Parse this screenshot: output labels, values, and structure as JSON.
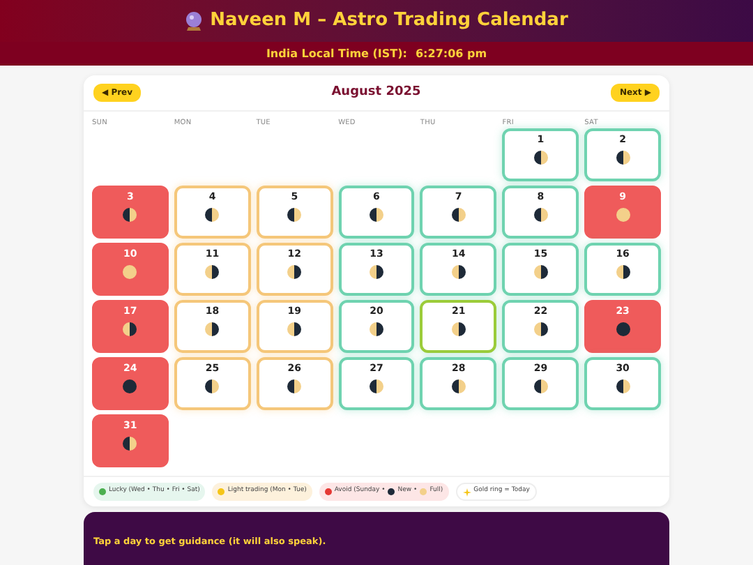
{
  "header": {
    "title": "Naveen M – Astro Trading Calendar"
  },
  "time_bar": {
    "label": "India Local Time (IST):",
    "time": "6:27:06 pm"
  },
  "calendar": {
    "prev": "◀ Prev",
    "month": "August 2025",
    "next": "Next ▶",
    "weekdays": [
      "SUN",
      "MON",
      "TUE",
      "WED",
      "THU",
      "FRI",
      "SAT"
    ],
    "days": [
      {
        "day": "1",
        "kind": "lucky",
        "moon": {
          "kind": "waxing"
        },
        "today": false
      },
      {
        "day": "2",
        "kind": "lucky",
        "moon": {
          "kind": "waxing"
        },
        "today": false
      },
      {
        "day": "3",
        "kind": "avoid",
        "moon": {
          "kind": "waxing"
        },
        "today": false
      },
      {
        "day": "4",
        "kind": "light",
        "moon": {
          "kind": "waxing"
        },
        "today": false
      },
      {
        "day": "5",
        "kind": "light",
        "moon": {
          "kind": "waxing"
        },
        "today": false
      },
      {
        "day": "6",
        "kind": "lucky",
        "moon": {
          "kind": "waxing"
        },
        "today": false
      },
      {
        "day": "7",
        "kind": "lucky",
        "moon": {
          "kind": "waxing"
        },
        "today": false
      },
      {
        "day": "8",
        "kind": "lucky",
        "moon": {
          "kind": "waxing"
        },
        "today": false
      },
      {
        "day": "9",
        "kind": "avoid",
        "moon": {
          "kind": "full"
        },
        "today": false
      },
      {
        "day": "10",
        "kind": "avoid",
        "moon": {
          "kind": "full"
        },
        "today": false
      },
      {
        "day": "11",
        "kind": "light",
        "moon": {
          "kind": "waning"
        },
        "today": false
      },
      {
        "day": "12",
        "kind": "light",
        "moon": {
          "kind": "waning"
        },
        "today": false
      },
      {
        "day": "13",
        "kind": "lucky",
        "moon": {
          "kind": "waning"
        },
        "today": false
      },
      {
        "day": "14",
        "kind": "lucky",
        "moon": {
          "kind": "waning"
        },
        "today": false
      },
      {
        "day": "15",
        "kind": "lucky",
        "moon": {
          "kind": "waning"
        },
        "today": false
      },
      {
        "day": "16",
        "kind": "lucky",
        "moon": {
          "kind": "waning"
        },
        "today": false
      },
      {
        "day": "17",
        "kind": "avoid",
        "moon": {
          "kind": "waning"
        },
        "today": false
      },
      {
        "day": "18",
        "kind": "light",
        "moon": {
          "kind": "waning"
        },
        "today": false
      },
      {
        "day": "19",
        "kind": "light",
        "moon": {
          "kind": "waning"
        },
        "today": false
      },
      {
        "day": "20",
        "kind": "lucky",
        "moon": {
          "kind": "waning"
        },
        "today": false
      },
      {
        "day": "21",
        "kind": "lucky",
        "moon": {
          "kind": "waning"
        },
        "today": true
      },
      {
        "day": "22",
        "kind": "lucky",
        "moon": {
          "kind": "waning"
        },
        "today": false
      },
      {
        "day": "23",
        "kind": "avoid",
        "moon": {
          "kind": "new"
        },
        "today": false
      },
      {
        "day": "24",
        "kind": "avoid",
        "moon": {
          "kind": "new"
        },
        "today": false
      },
      {
        "day": "25",
        "kind": "light",
        "moon": {
          "kind": "waxing"
        },
        "today": false
      },
      {
        "day": "26",
        "kind": "light",
        "moon": {
          "kind": "waxing"
        },
        "today": false
      },
      {
        "day": "27",
        "kind": "lucky",
        "moon": {
          "kind": "waxing"
        },
        "today": false
      },
      {
        "day": "28",
        "kind": "lucky",
        "moon": {
          "kind": "waxing"
        },
        "today": false
      },
      {
        "day": "29",
        "kind": "lucky",
        "moon": {
          "kind": "waxing"
        },
        "today": false
      },
      {
        "day": "30",
        "kind": "lucky",
        "moon": {
          "kind": "waxing"
        },
        "today": false
      },
      {
        "day": "31",
        "kind": "avoid",
        "moon": {
          "kind": "waxing"
        },
        "today": false
      }
    ]
  },
  "legend": [
    {
      "kind": "lucky",
      "color": "#4caf50",
      "parts": [
        {
          "text": "Lucky (Wed • Thu • Fri • Sat)"
        }
      ]
    },
    {
      "kind": "light",
      "color": "#f5c518",
      "parts": [
        {
          "text": "Light trading (Mon • Tue)"
        }
      ]
    },
    {
      "kind": "avoid",
      "color": "#e53935",
      "parts": [
        {
          "text": "Avoid (Sunday •"
        },
        {
          "kind": "new"
        },
        {
          "text": "New •"
        },
        {
          "kind": "full"
        },
        {
          "text": "Full)"
        }
      ]
    },
    {
      "kind": "today",
      "parts": [
        {
          "text": "Gold ring = Today"
        }
      ]
    }
  ],
  "guidance": {
    "text": "Tap a day to get guidance (it will also speak)."
  }
}
